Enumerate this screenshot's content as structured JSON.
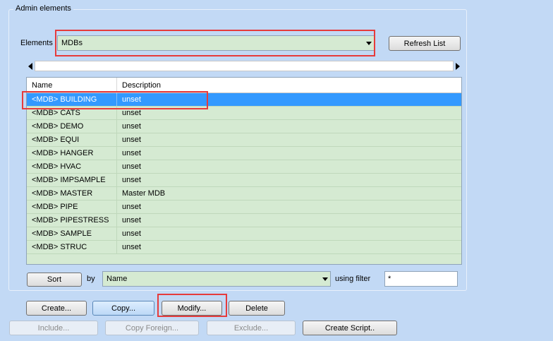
{
  "group": {
    "title": "Admin elements"
  },
  "elements": {
    "label": "Elements",
    "value": "MDBs",
    "refresh_label": "Refresh List"
  },
  "table": {
    "columns": [
      "Name",
      "Description"
    ],
    "rows": [
      {
        "name": "<MDB>  BUILDING",
        "desc": "unset",
        "selected": true
      },
      {
        "name": "<MDB>  CATS",
        "desc": "unset"
      },
      {
        "name": "<MDB>  DEMO",
        "desc": "unset"
      },
      {
        "name": "<MDB>  EQUI",
        "desc": "unset"
      },
      {
        "name": "<MDB>  HANGER",
        "desc": "unset"
      },
      {
        "name": "<MDB>  HVAC",
        "desc": "unset"
      },
      {
        "name": "<MDB>  IMPSAMPLE",
        "desc": "unset"
      },
      {
        "name": "<MDB>  MASTER",
        "desc": "Master MDB"
      },
      {
        "name": "<MDB>  PIPE",
        "desc": "unset"
      },
      {
        "name": "<MDB>  PIPESTRESS",
        "desc": "unset"
      },
      {
        "name": "<MDB>  SAMPLE",
        "desc": "unset"
      },
      {
        "name": "<MDB>  STRUC",
        "desc": "unset"
      }
    ]
  },
  "sort": {
    "button_label": "Sort",
    "by_label": "by",
    "by_value": "Name",
    "filter_label": "using filter",
    "filter_value": "*"
  },
  "actions": {
    "create": "Create...",
    "copy": "Copy...",
    "modify": "Modify...",
    "delete": "Delete",
    "include": "Include...",
    "copy_foreign": "Copy Foreign...",
    "exclude": "Exclude...",
    "create_script": "Create Script.."
  },
  "colors": {
    "background": "#c2d9f5",
    "list_background": "#d5ead2",
    "selection": "#3399ff",
    "highlight_box": "#e63b3b"
  }
}
